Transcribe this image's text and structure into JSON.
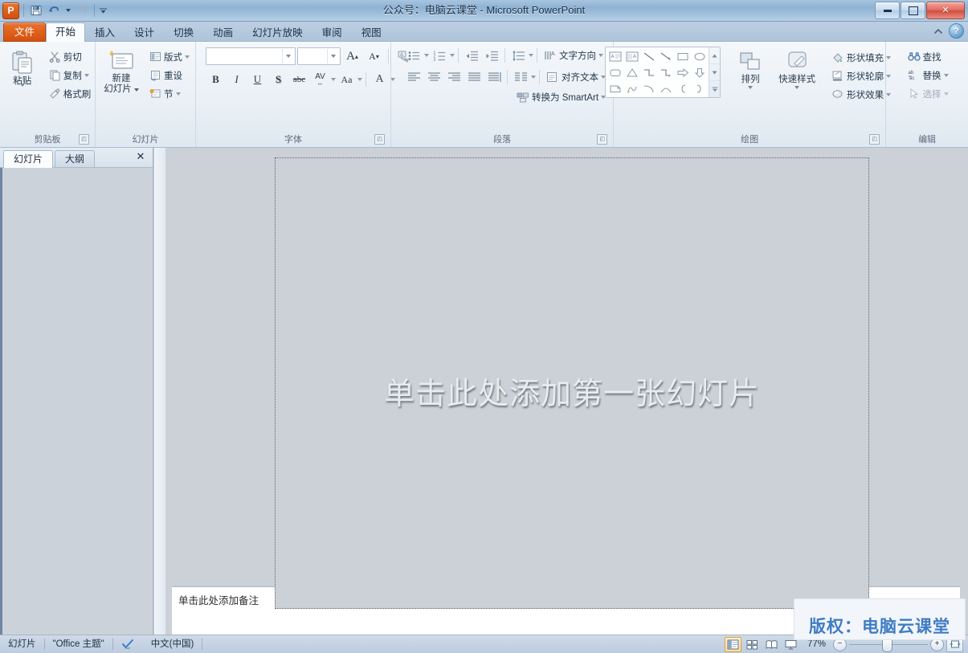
{
  "window": {
    "title": "公众号：电脑云课堂  -  Microsoft PowerPoint",
    "minimize_label": "最小化",
    "restore_label": "还原",
    "close_label": "✕"
  },
  "quick_access": {
    "logo": "P",
    "save_label": "保存",
    "undo_label": "撤消",
    "redo_label": "恢复",
    "customize_label": "自定义快速访问工具栏"
  },
  "tabs": [
    {
      "label": "文件",
      "type": "file"
    },
    {
      "label": "开始",
      "active": true
    },
    {
      "label": "插入"
    },
    {
      "label": "设计"
    },
    {
      "label": "切换"
    },
    {
      "label": "动画"
    },
    {
      "label": "幻灯片放映"
    },
    {
      "label": "审阅"
    },
    {
      "label": "视图"
    }
  ],
  "ribbon_right": {
    "collapse_label": "功能区最小化",
    "help_label": "?"
  },
  "ribbon": {
    "clipboard": {
      "label": "剪贴板",
      "paste": "粘贴",
      "cut": "剪切",
      "copy": "复制",
      "format_painter": "格式刷"
    },
    "slides": {
      "label": "幻灯片",
      "new_slide_line1": "新建",
      "new_slide_line2": "幻灯片",
      "layout": "版式",
      "reset": "重设",
      "section": "节"
    },
    "font": {
      "label": "字体",
      "font_name_value": "",
      "font_size_value": "",
      "grow_font": "A",
      "shrink_font": "A",
      "clear_formatting": "清除所有格式",
      "bold": "B",
      "italic": "I",
      "underline": "U",
      "shadow": "S",
      "strikethrough": "abc",
      "character_spacing": "AV",
      "change_case": "Aa",
      "font_color": "A"
    },
    "paragraph": {
      "label": "段落",
      "text_direction": "文字方向",
      "align_text": "对齐文本",
      "convert_smartart": "转换为 SmartArt"
    },
    "drawing": {
      "label": "绘图",
      "arrange": "排列",
      "quick_styles_line1": "快速样式",
      "shape_fill": "形状填充",
      "shape_outline": "形状轮廓",
      "shape_effects": "形状效果"
    },
    "editing": {
      "label": "编辑",
      "find": "查找",
      "replace": "替换",
      "select": "选择"
    }
  },
  "slide_panel": {
    "tab_slides": "幻灯片",
    "tab_outline": "大纲",
    "close_label": "✕"
  },
  "slide_area": {
    "placeholder": "单击此处添加第一张幻灯片",
    "notes_placeholder": "单击此处添加备注"
  },
  "status_bar": {
    "slide_label": "幻灯片",
    "theme": "\"Office 主题\"",
    "language": "中文(中国)",
    "spellcheck_label": "拼写检查",
    "zoom_value": "77%",
    "zoom_out": "−",
    "zoom_in": "+",
    "view_normal": "普通视图",
    "view_sorter": "幻灯片浏览",
    "view_reading": "阅读视图",
    "view_show": "幻灯片放映",
    "fit_window": "按当前窗口调整幻灯片大小"
  },
  "watermark": {
    "text": "版权：电脑云课堂"
  },
  "colors": {
    "file_tab": "#d4500f",
    "accent_blue": "#3f7cc4",
    "title_bar": "#9cbcd9",
    "slide_bg": "#ccd1d7"
  }
}
